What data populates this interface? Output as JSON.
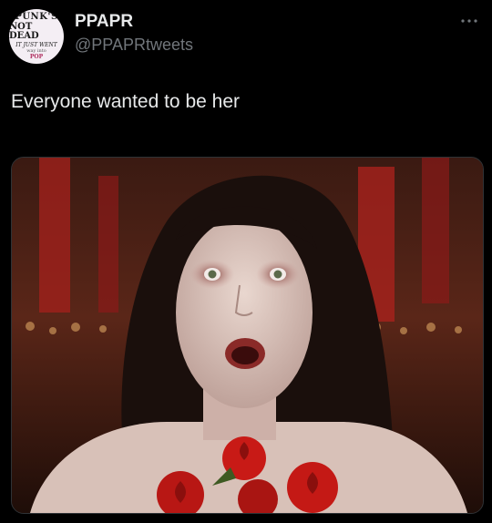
{
  "author": {
    "display_name": "PPAPR",
    "handle": "@PPAPRtweets",
    "avatar_text": {
      "line1": "PUNK'S",
      "line2": "NOT DEAD",
      "line3": "IT JUST WENT",
      "line4": "way into",
      "line5": "POP"
    }
  },
  "tweet": {
    "text": "Everyone wanted to be her"
  },
  "icons": {
    "more": "more-horizontal-icon"
  },
  "colors": {
    "background": "#000000",
    "primary_text": "#e7e9ea",
    "secondary_text": "#71767b"
  }
}
